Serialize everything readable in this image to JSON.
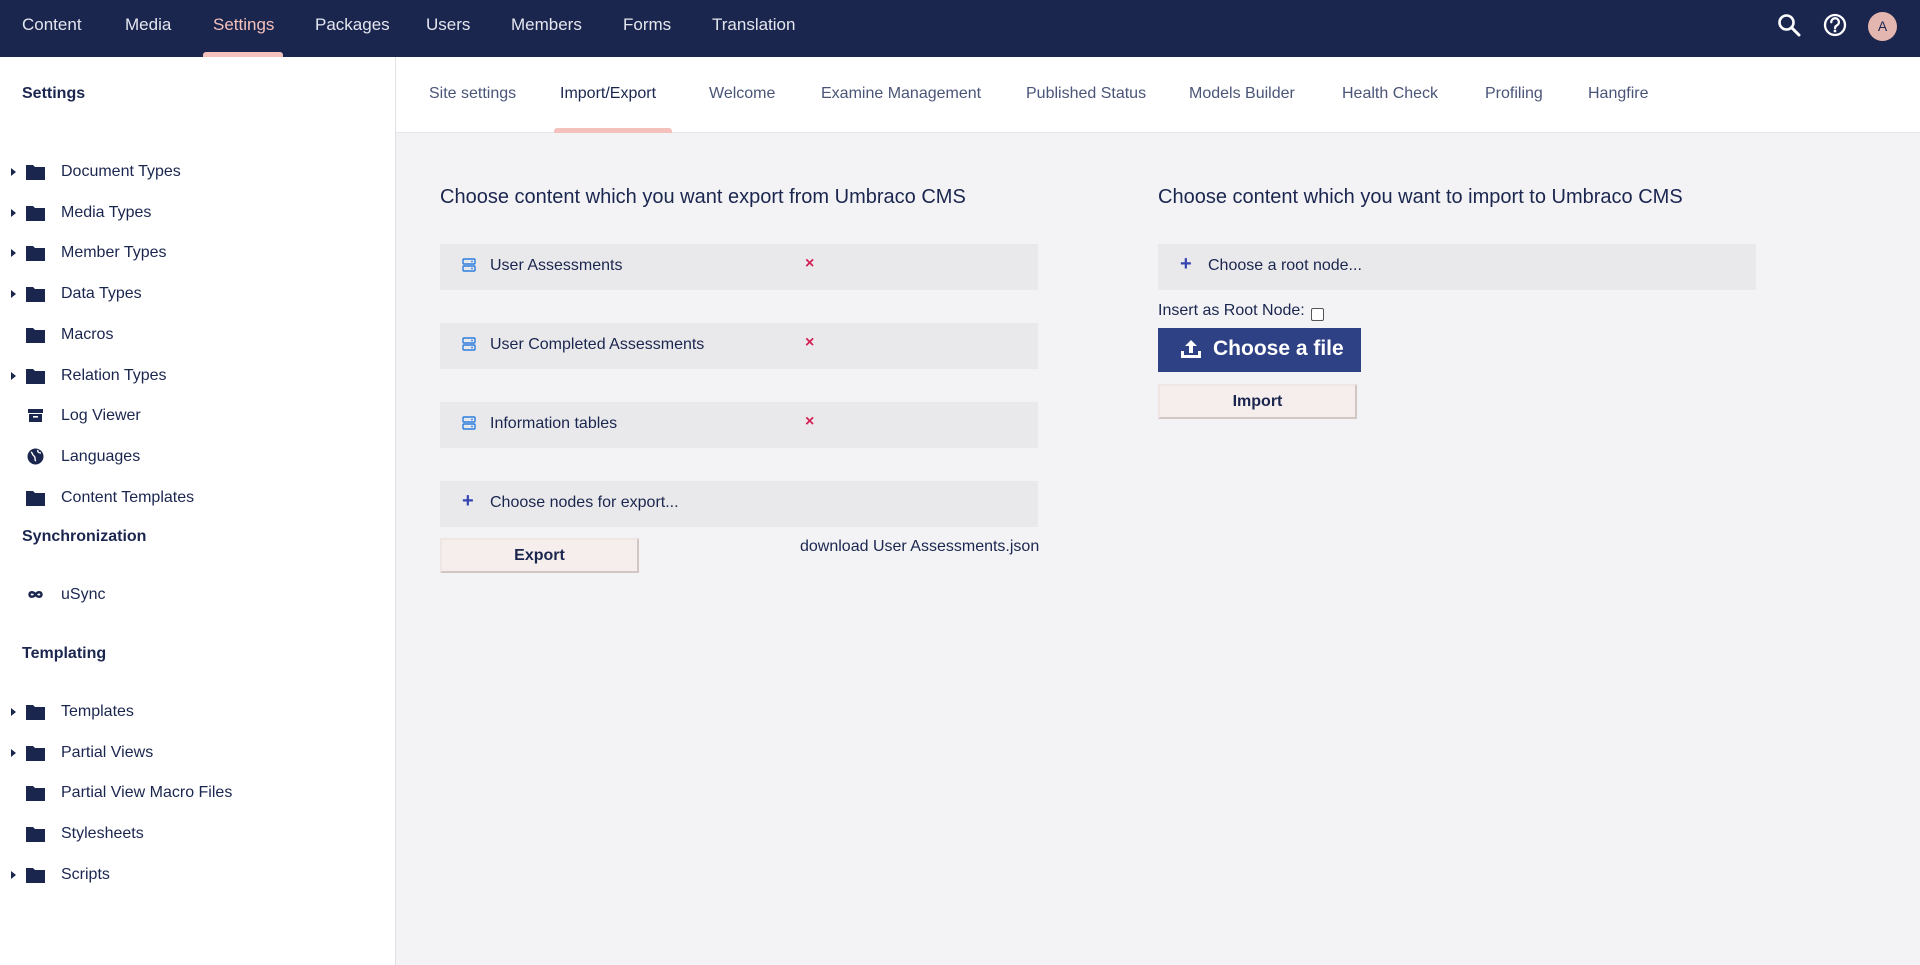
{
  "topnav": {
    "items": [
      {
        "label": "Content",
        "active": false
      },
      {
        "label": "Media",
        "active": false
      },
      {
        "label": "Settings",
        "active": true
      },
      {
        "label": "Packages",
        "active": false
      },
      {
        "label": "Users",
        "active": false
      },
      {
        "label": "Members",
        "active": false
      },
      {
        "label": "Forms",
        "active": false
      },
      {
        "label": "Translation",
        "active": false
      }
    ],
    "avatar_initial": "A"
  },
  "sidebar": {
    "settings_title": "Settings",
    "settings_items": [
      {
        "label": "Document Types",
        "icon": "folder-icon",
        "expandable": true
      },
      {
        "label": "Media Types",
        "icon": "folder-icon",
        "expandable": true
      },
      {
        "label": "Member Types",
        "icon": "folder-icon",
        "expandable": true
      },
      {
        "label": "Data Types",
        "icon": "folder-icon",
        "expandable": true
      },
      {
        "label": "Macros",
        "icon": "folder-icon",
        "expandable": false
      },
      {
        "label": "Relation Types",
        "icon": "folder-icon",
        "expandable": true
      },
      {
        "label": "Log Viewer",
        "icon": "archive-icon",
        "expandable": false
      },
      {
        "label": "Languages",
        "icon": "globe-icon",
        "expandable": false
      },
      {
        "label": "Content Templates",
        "icon": "folder-icon",
        "expandable": false
      }
    ],
    "sync_title": "Synchronization",
    "sync_items": [
      {
        "label": "uSync",
        "icon": "infinity-icon",
        "expandable": false
      }
    ],
    "templating_title": "Templating",
    "templating_items": [
      {
        "label": "Templates",
        "icon": "folder-icon",
        "expandable": true
      },
      {
        "label": "Partial Views",
        "icon": "folder-icon",
        "expandable": true
      },
      {
        "label": "Partial View Macro Files",
        "icon": "folder-icon",
        "expandable": false
      },
      {
        "label": "Stylesheets",
        "icon": "folder-icon",
        "expandable": false
      },
      {
        "label": "Scripts",
        "icon": "folder-icon",
        "expandable": true
      }
    ]
  },
  "tabs": [
    {
      "label": "Site settings",
      "active": false
    },
    {
      "label": "Import/Export",
      "active": true
    },
    {
      "label": "Welcome",
      "active": false
    },
    {
      "label": "Examine Management",
      "active": false
    },
    {
      "label": "Published Status",
      "active": false
    },
    {
      "label": "Models Builder",
      "active": false
    },
    {
      "label": "Health Check",
      "active": false
    },
    {
      "label": "Profiling",
      "active": false
    },
    {
      "label": "Hangfire",
      "active": false
    }
  ],
  "export": {
    "heading": "Choose content which you want export from Umbraco CMS",
    "selected_nodes": [
      {
        "label": "User Assessments"
      },
      {
        "label": "User Completed Assessments"
      },
      {
        "label": "Information tables"
      }
    ],
    "remove_glyph": "×",
    "choose_label": "Choose nodes for export...",
    "export_button": "Export",
    "download_link": "download User Assessments.json"
  },
  "import": {
    "heading": "Choose content which you want to import to Umbraco CMS",
    "choose_root_label": "Choose a root node...",
    "insert_root_label": "Insert as Root Node:",
    "insert_root_checked": false,
    "choose_file_button": "Choose a file",
    "import_button": "Import"
  },
  "colors": {
    "nav_bg": "#1b264f",
    "accent": "#f5c1bc",
    "primary_button": "#2e4185",
    "remove": "#d42054",
    "plus": "#3544b1"
  }
}
